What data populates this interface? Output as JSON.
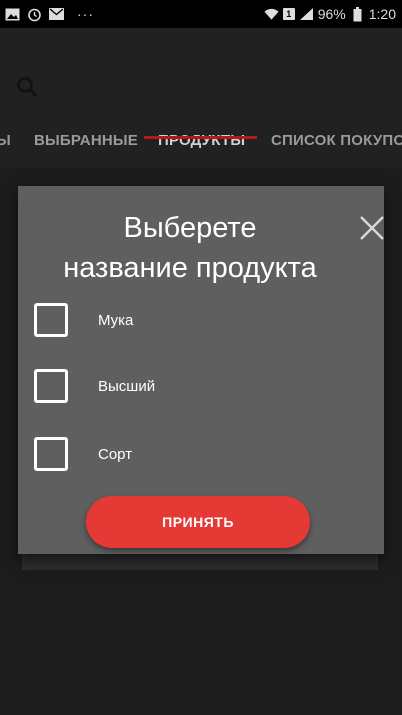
{
  "status_bar": {
    "battery_percent": "96%",
    "time": "1:20",
    "sim_badge": "1",
    "more_dots": "···"
  },
  "tabs": [
    {
      "label": "Ы",
      "active": false
    },
    {
      "label": "ВЫБРАННЫЕ",
      "active": false
    },
    {
      "label": "ПРОДУКТЫ",
      "active": true
    },
    {
      "label": "СПИСОК ПОКУПО",
      "active": false
    }
  ],
  "dialog": {
    "title_line1": "Выберете",
    "title_line2": "название продукта",
    "options": [
      {
        "label": "Мука",
        "checked": false
      },
      {
        "label": "Высший",
        "checked": false
      },
      {
        "label": "Сорт",
        "checked": false
      }
    ],
    "accept_label": "ПРИНЯТЬ"
  },
  "colors": {
    "accent": "#e53935",
    "tab_indicator": "#b5171b",
    "dialog_bg": "#5f5f5f",
    "app_bar_bg": "#212121"
  },
  "icons": [
    "image-icon",
    "alarm-icon",
    "mail-icon",
    "wifi-icon",
    "signal-icon",
    "battery-icon",
    "search-icon",
    "close-icon"
  ]
}
